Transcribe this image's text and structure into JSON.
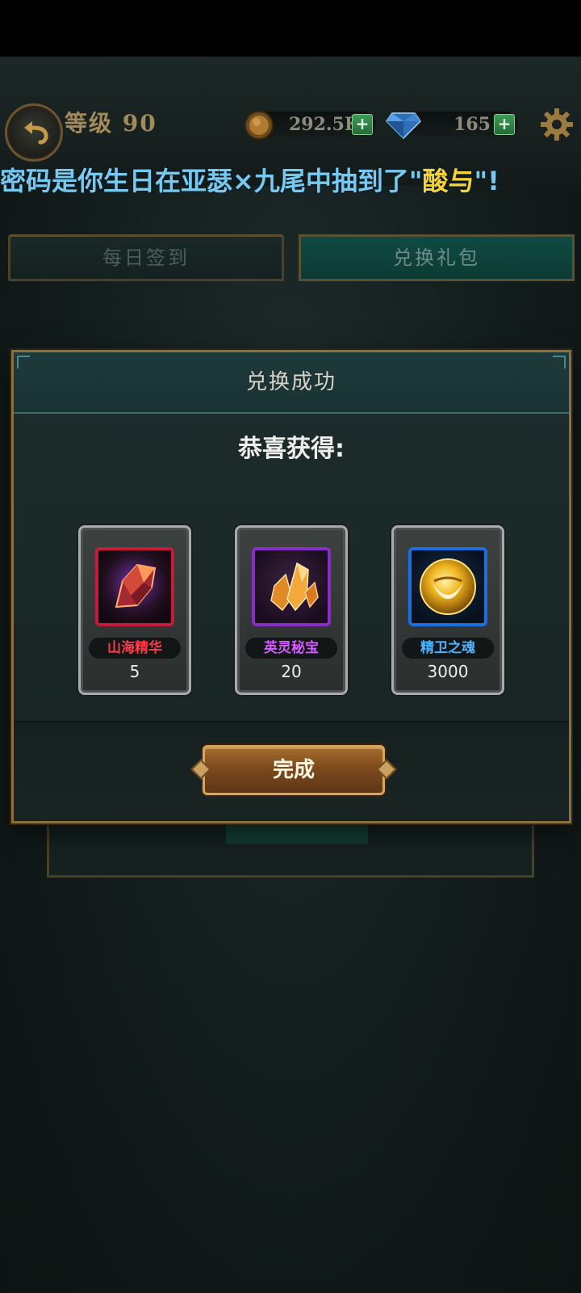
{
  "header": {
    "level_label": "等级 90",
    "coins": "292.5K",
    "gems": "165",
    "plus_label": "+"
  },
  "announcement": {
    "text_before": "密码是你生日在亚瑟×九尾中抽到了\"",
    "highlight": "酸与",
    "text_after": "\"!"
  },
  "tabs": [
    {
      "label": "每日签到",
      "active": false
    },
    {
      "label": "兑换礼包",
      "active": true
    }
  ],
  "background_panel": {
    "button_label": "完成"
  },
  "modal": {
    "title": "兑换成功",
    "congrats": "恭喜获得:",
    "rewards": [
      {
        "name": "山海精华",
        "quantity": "5",
        "icon": "essence-crystal-icon",
        "rarity_color": "#c21c3a"
      },
      {
        "name": "英灵秘宝",
        "quantity": "20",
        "icon": "orange-crystal-icon",
        "rarity_color": "#8a2cc9"
      },
      {
        "name": "精卫之魂",
        "quantity": "3000",
        "icon": "golden-orb-icon",
        "rarity_color": "#1b6fe0"
      }
    ],
    "done_label": "完成"
  },
  "colors": {
    "announcement_text": "#78c9f0",
    "announcement_highlight": "#f4d23a",
    "frame_gold": "#8a6f3f"
  }
}
